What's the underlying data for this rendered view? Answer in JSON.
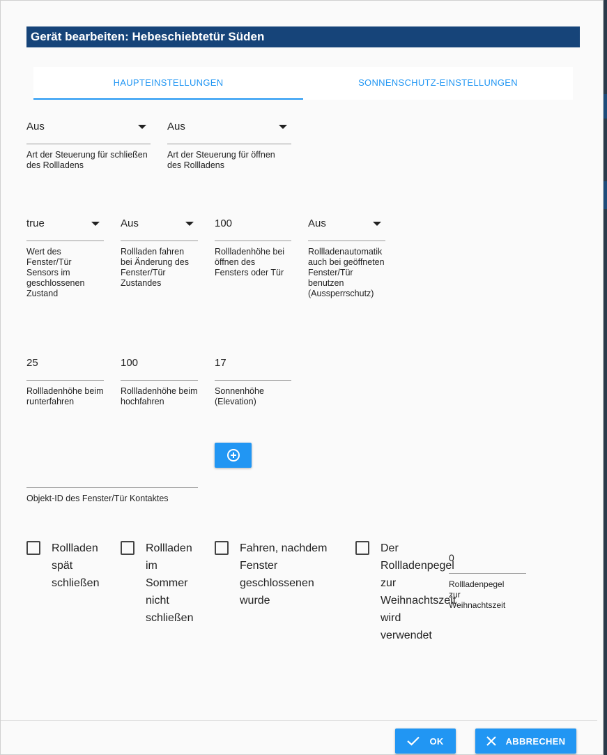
{
  "dialog": {
    "title": "Gerät bearbeiten: Hebeschiebtetür Süden"
  },
  "tabs": [
    {
      "label": "HAUPTEINSTELLUNGEN",
      "active": true
    },
    {
      "label": "SONNENSCHUTZ-EINSTELLUNGEN",
      "active": false
    }
  ],
  "row1": {
    "close_control": {
      "value": "Aus",
      "label": "Art der Steuerung für schließen des Rollladens"
    },
    "open_control": {
      "value": "Aus",
      "label": "Art der Steuerung für öffnen des Rollladens"
    }
  },
  "row2": {
    "sensor_value": {
      "value": "true",
      "label": "Wert des Fenster/Tür Sensors im geschlossenen Zustand"
    },
    "move_on_change": {
      "value": "Aus",
      "label": "Rollladen fahren bei Änderung des Fenster/Tür Zustandes"
    },
    "height_on_open": {
      "value": "100",
      "label": "Rollladenhöhe bei öffnen des Fensters oder Tür"
    },
    "auto_open": {
      "value": "Aus",
      "label": "Rollladenautomatik auch bei geöffneten Fenster/Tür benutzen (Aussperrschutz)"
    }
  },
  "row3": {
    "height_down": {
      "value": "25",
      "label": "Rollladenhöhe beim runterfahren"
    },
    "height_up": {
      "value": "100",
      "label": "Rollladenhöhe beim hochfahren"
    },
    "elevation": {
      "value": "17",
      "label": "Sonnenhöhe (Elevation)"
    }
  },
  "object_id": {
    "value": "",
    "label": "Objekt-ID des Fenster/Tür Kontaktes"
  },
  "checkboxes": [
    {
      "label": "Rollladen spät schließen",
      "checked": false
    },
    {
      "label": "Rollladen im Sommer nicht schließen",
      "checked": false
    },
    {
      "label": "Fahren, nachdem Fenster geschlossenen wurde",
      "checked": false
    },
    {
      "label": "Der Rollladenpegel zur Weihnachtszeit wird verwendet",
      "checked": false
    }
  ],
  "xmas_level": {
    "value": "0",
    "label": "Rollladenpegel zur Weihnachtszeit"
  },
  "footer": {
    "ok_label": "OK",
    "cancel_label": "ABBRECHEN"
  },
  "colors": {
    "title_bg": "#164479",
    "accent": "#2196f3"
  },
  "icons": {
    "add": "add-circle-icon",
    "ok": "check-icon",
    "cancel": "close-icon",
    "dropdown": "arrow-drop-down-icon"
  }
}
